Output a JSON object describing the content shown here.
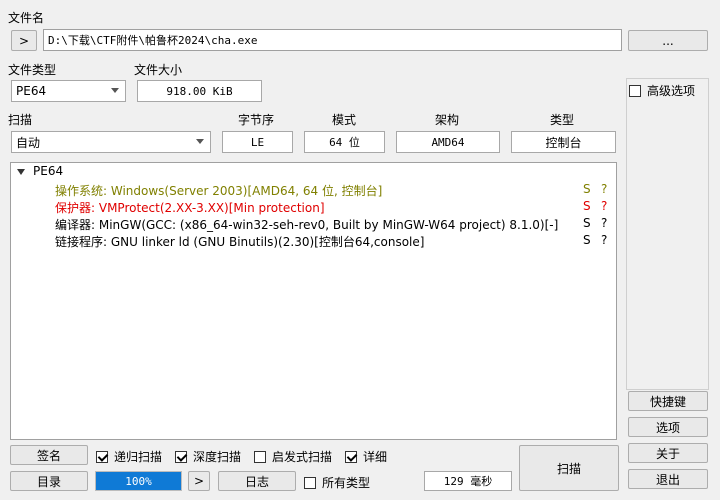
{
  "labels": {
    "file_name": "文件名",
    "file_type": "文件类型",
    "file_size": "文件大小",
    "scan": "扫描",
    "endian": "字节序",
    "mode": "模式",
    "arch": "架构",
    "type": "类型"
  },
  "file": {
    "path": "D:\\下载\\CTF附件\\帕鲁杯2024\\cha.exe",
    "expand_btn": ">",
    "browse_btn": "..."
  },
  "file_type_value": "PE64",
  "file_size_value": "918.00 KiB",
  "scan_mode_value": "自动",
  "endian_value": "LE",
  "mode_value": "64 位",
  "arch_value": "AMD64",
  "type_value": "控制台",
  "advanced_option": "高级选项",
  "results": {
    "root": "PE64",
    "rows": [
      {
        "text": "操作系统: Windows(Server 2003)[AMD64, 64 位, 控制台]",
        "s": "S",
        "q": "?",
        "color": "#808000"
      },
      {
        "text": "保护器: VMProtect(2.XX-3.XX)[Min protection]",
        "s": "S",
        "q": "?",
        "color": "#e00000"
      },
      {
        "text": "编译器: MinGW(GCC: (x86_64-win32-seh-rev0, Built by MinGW-W64 project) 8.1.0)[-]",
        "s": "S",
        "q": "?",
        "color": "#000000"
      },
      {
        "text": "链接程序: GNU linker ld (GNU Binutils)(2.30)[控制台64,console]",
        "s": "S",
        "q": "?",
        "color": "#000000"
      }
    ]
  },
  "side_buttons": {
    "shortcuts": "快捷键",
    "options": "选项",
    "about": "关于",
    "exit": "退出"
  },
  "bottom": {
    "signature": "签名",
    "recursive_scan": "递归扫描",
    "deep_scan": "深度扫描",
    "heuristic_scan": "启发式扫描",
    "verbose": "详细",
    "directory": "目录",
    "progress_text": "100%",
    "progress": 1.0,
    "next": ">",
    "log": "日志",
    "all_types": "所有类型",
    "elapsed": "129 毫秒",
    "scan_button": "扫描"
  },
  "colors": {
    "progress": "#0f7ad6",
    "os_row": "#808000",
    "protector_row": "#e00000"
  }
}
